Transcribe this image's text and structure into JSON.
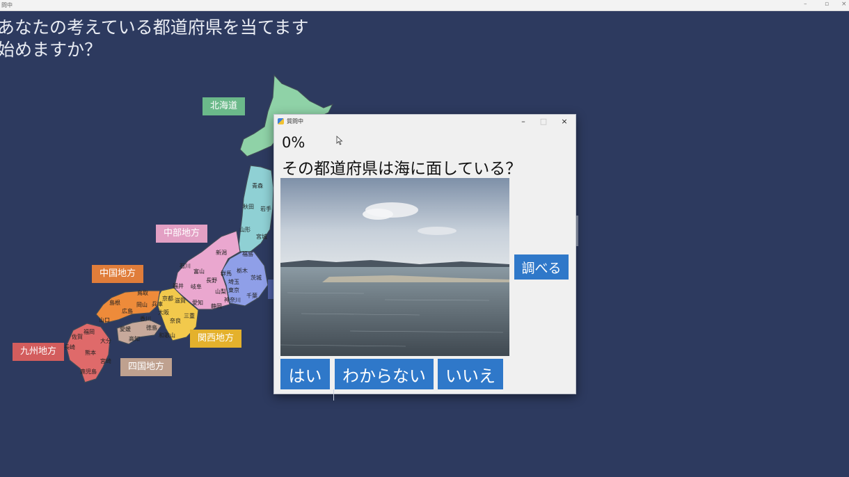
{
  "window": {
    "title": "問中",
    "controls": [
      "–",
      "▫",
      "×"
    ]
  },
  "background": {
    "line1": "あなたの考えている都道府県を当てます",
    "line2": "始めますか？"
  },
  "map": {
    "regions": [
      {
        "name": "北海道",
        "color": "#6bb98a"
      },
      {
        "name": "中部地方",
        "color": "#e3a0c4"
      },
      {
        "name": "中国地方",
        "color": "#e07d3a"
      },
      {
        "name": "関西地方",
        "color": "#e4b12c"
      },
      {
        "name": "四国地方",
        "color": "#bfa18f"
      },
      {
        "name": "九州地方",
        "color": "#d35d5d"
      }
    ],
    "prefectures": [
      "青森",
      "秋田",
      "岩手",
      "山形",
      "宮城",
      "福島",
      "新潟",
      "石川",
      "富山",
      "群馬",
      "栃木",
      "茨城",
      "福井",
      "長野",
      "埼玉",
      "岐阜",
      "山梨",
      "東京",
      "千葉",
      "神奈川",
      "愛知",
      "静岡",
      "滋賀",
      "京都",
      "鳥取",
      "島根",
      "岡山",
      "兵庫",
      "大阪",
      "広島",
      "山口",
      "香川",
      "奈良",
      "三重",
      "和歌山",
      "愛媛",
      "徳島",
      "高知",
      "福岡",
      "佐賀",
      "大分",
      "長崎",
      "熊本",
      "宮崎",
      "鹿児島"
    ]
  },
  "dialog": {
    "title": "質問中",
    "controls": [
      "–",
      "□",
      "×"
    ],
    "progress": "0%",
    "question": "その都道府県は海に面している？",
    "image_description": "seaside beach photo",
    "buttons": {
      "search": "調べる",
      "yes": "はい",
      "unknown": "わからない",
      "no": "いいえ"
    }
  },
  "colors": {
    "background": "#2d3a5f",
    "button": "#2f78c9",
    "dialog": "#f0f0f0"
  }
}
